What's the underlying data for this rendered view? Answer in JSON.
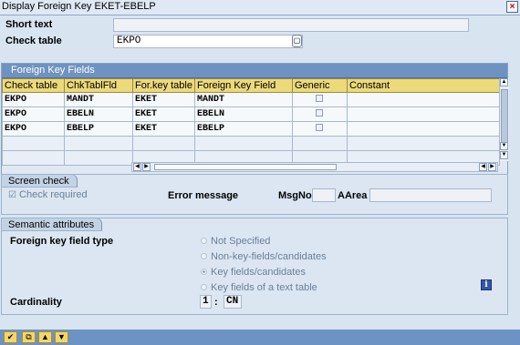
{
  "window": {
    "title": "Display Foreign Key EKET-EBELP"
  },
  "header": {
    "short_text_label": "Short text",
    "short_text_value": "",
    "check_table_label": "Check table",
    "check_table_value": "EKPO"
  },
  "fk_table": {
    "title": "Foreign Key Fields",
    "columns": [
      "Check table",
      "ChkTablFld",
      "For.key table",
      "Foreign Key Field",
      "Generic",
      "Constant"
    ],
    "rows": [
      [
        "EKPO",
        "MANDT",
        "EKET",
        "MANDT"
      ],
      [
        "EKPO",
        "EBELN",
        "EKET",
        "EBELN"
      ],
      [
        "EKPO",
        "EBELP",
        "EKET",
        "EBELP"
      ]
    ]
  },
  "screen_check": {
    "title": "Screen check",
    "check_required_label": "Check required",
    "error_message_label": "Error message",
    "msgno_label": "MsgNo",
    "msgno_value": "",
    "aarea_label": "AArea",
    "aarea_value": ""
  },
  "semantic": {
    "title": "Semantic attributes",
    "fk_field_type_label": "Foreign key field type",
    "options": [
      "Not Specified",
      "Non-key-fields/candidates",
      "Key fields/candidates",
      "Key fields of a text table"
    ],
    "selected_option": "Key fields/candidates",
    "cardinality_label": "Cardinality",
    "cardinality_left": "1",
    "cardinality_sep": ":",
    "cardinality_right": "CN"
  },
  "icons": {
    "close": "close-icon",
    "f4": "f4-help-icon",
    "info": "info-icon",
    "toolbar": [
      "check-icon",
      "copy-icon",
      "arrow-up-icon",
      "arrow-down-icon"
    ]
  },
  "colors": {
    "table_header": "#ecd97a",
    "table_title": "#6f93c1",
    "toolbar": "#6d93c4"
  }
}
